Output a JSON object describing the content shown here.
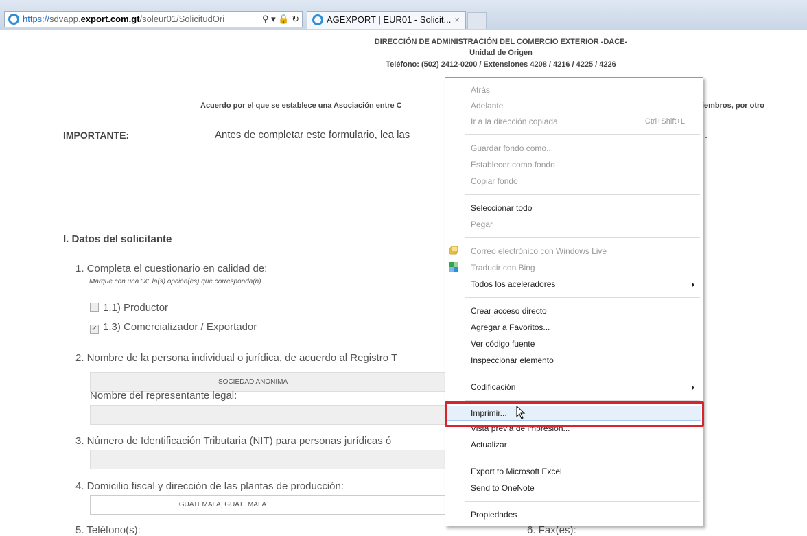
{
  "browser": {
    "url_prefix": "https://",
    "url_host_a": "sdvapp.",
    "url_host_b": "export.com.gt",
    "url_path": "/soleur01/SolicitudOri",
    "url_tools": "⚲ ▾ 🔒 ↻",
    "tab_title": "AGEXPORT | EUR01 - Solicit...",
    "tab_close": "×"
  },
  "page": {
    "header_line1": "DIRECCIÓN DE ADMINISTRACIÓN DEL COMERCIO EXTERIOR -DACE-",
    "header_line2": "Unidad de Origen",
    "header_line3": "Teléfono: (502) 2412-0200 / Extensiones 4208 / 4216 / 4225 / 4226",
    "acuerdo_left": "Acuerdo por el que se establece una Asociación entre C",
    "acuerdo_right": "s miembros, por otro",
    "important_label": "IMPORTANTE:",
    "important_text": "Antes de completar este formulario, lea las",
    "important_tail": ".",
    "section_title": "I. Datos del solicitante",
    "q1": "1.  Completa el cuestionario en calidad de:",
    "q1_hint": "Marque con una \"X\" la(s) opción(es) que corresponda(n)",
    "opt1": "1.1) Productor",
    "opt1_checked": false,
    "opt3": "1.3) Comercializador / Exportador",
    "opt3_checked": true,
    "q2": "2.  Nombre de la persona individual o jurídica, de acuerdo al Registro T",
    "q2_value": "SOCIEDAD ANONIMA",
    "q2_legal": "Nombre del representante legal:",
    "q3": "3.  Número de Identificación Tributaria (NIT) para personas jurídicas ó",
    "q4": "4.  Domicilio fiscal y dirección de las plantas de producción:",
    "q4_value": ",GUATEMALA, GUATEMALA",
    "q5": "5.  Teléfono(s):",
    "q6": "6.  Fax(es):"
  },
  "context_menu": {
    "back": "Atrás",
    "forward": "Adelante",
    "goto_copied": "Ir a la dirección copiada",
    "goto_shortcut": "Ctrl+Shift+L",
    "save_background": "Guardar fondo como...",
    "set_background": "Establecer como fondo",
    "copy_background": "Copiar fondo",
    "select_all": "Seleccionar todo",
    "paste": "Pegar",
    "email_live": "Correo electrónico con Windows Live",
    "translate_bing": "Traducir con Bing",
    "all_accelerators": "Todos los aceleradores",
    "create_shortcut": "Crear acceso directo",
    "add_favorites": "Agregar a Favoritos...",
    "view_source": "Ver código fuente",
    "inspect": "Inspeccionar elemento",
    "encoding": "Codificación",
    "print": "Imprimir...",
    "print_preview": "Vista previa de impresión...",
    "refresh": "Actualizar",
    "export_excel": "Export to Microsoft Excel",
    "send_onenote": "Send to OneNote",
    "properties": "Propiedades"
  },
  "colors": {
    "highlight_border": "#d8252d",
    "ie_blue": "#2c8fd8"
  }
}
